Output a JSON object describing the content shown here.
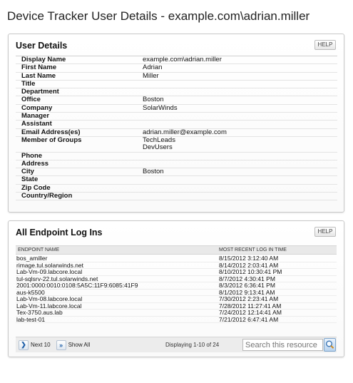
{
  "page": {
    "title": "Device Tracker User Details - example.com\\adrian.miller"
  },
  "user_details": {
    "title": "User Details",
    "help_label": "HELP",
    "rows": [
      {
        "label": "Display Name",
        "values": [
          "example.com\\adrian.miller"
        ]
      },
      {
        "label": "First Name",
        "values": [
          "Adrian"
        ]
      },
      {
        "label": "Last Name",
        "values": [
          "Miller"
        ]
      },
      {
        "label": "Title",
        "values": [
          ""
        ]
      },
      {
        "label": "Department",
        "values": [
          ""
        ]
      },
      {
        "label": "Office",
        "values": [
          "Boston"
        ]
      },
      {
        "label": "Company",
        "values": [
          "SolarWinds"
        ]
      },
      {
        "label": "Manager",
        "values": [
          ""
        ]
      },
      {
        "label": "Assistant",
        "values": [
          ""
        ]
      },
      {
        "label": "Email Address(es)",
        "values": [
          "adrian.miller@example.com"
        ]
      },
      {
        "label": "Member of Groups",
        "values": [
          "TechLeads",
          "DevUsers"
        ]
      },
      {
        "label": "Phone",
        "values": [
          ""
        ]
      },
      {
        "label": "Address",
        "values": [
          ""
        ]
      },
      {
        "label": "City",
        "values": [
          "Boston"
        ]
      },
      {
        "label": "State",
        "values": [
          ""
        ]
      },
      {
        "label": "Zip Code",
        "values": [
          ""
        ]
      },
      {
        "label": "Country/Region",
        "values": [
          ""
        ]
      }
    ]
  },
  "endpoints": {
    "title": "All Endpoint Log Ins",
    "help_label": "HELP",
    "columns": [
      "ENDPOINT NAME",
      "MOST RECENT LOG IN TIME"
    ],
    "rows": [
      [
        "bos_amiller",
        "8/15/2012 3:12:40 AM"
      ],
      [
        "rimage.tul.solarwinds.net",
        "8/14/2012 2:03:41 AM"
      ],
      [
        "Lab-Vm-09.labcore.local",
        "8/10/2012 10:30:41 PM"
      ],
      [
        "tul-sqlsrv-22.tul.solarwinds.net",
        "8/7/2012 4:30:41 PM"
      ],
      [
        "2001:0000:0010:0108:5A5C:11F9:6085:41F9",
        "8/3/2012 6:36:41 PM"
      ],
      [
        "aus-k5500",
        "8/1/2012 9:13:41 AM"
      ],
      [
        "Lab-Vm-08.labcore.local",
        "7/30/2012 2:23:41 AM"
      ],
      [
        "Lab-Vm-11.labcore.local",
        "7/28/2012 11:27:41 AM"
      ],
      [
        "Tex-3750.aus.lab",
        "7/24/2012 12:14:41 AM"
      ],
      [
        "lab-test-01",
        "7/21/2012 6:47:41 AM"
      ]
    ],
    "pager": {
      "next_label": "Next 10",
      "show_all_label": "Show All",
      "info": "Displaying 1-10 of 24",
      "search_placeholder": "Search this resource"
    }
  }
}
